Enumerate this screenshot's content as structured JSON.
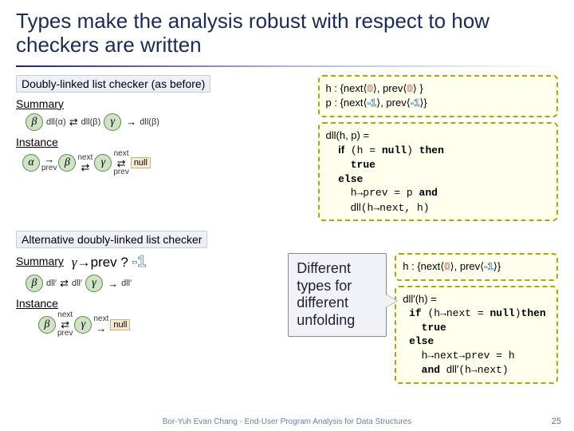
{
  "title": "Types make the analysis robust with respect to how checkers are written",
  "label1": "Doubly-linked list checker (as before)",
  "summary": "Summary",
  "instance": "Instance",
  "greek": {
    "alpha": "α",
    "beta": "β",
    "gamma": "γ"
  },
  "edge": {
    "dla": "dll(α)",
    "dlb": "dll(β)",
    "dl2": "dll′",
    "next": "next",
    "prev": "prev"
  },
  "null": "null",
  "spec1": "h : {next⟨0⟩, prev⟨0⟩ }\np : {next⟨-1⟩, prev⟨-1⟩}",
  "code1_fn": "dll(h, p) =",
  "code1_l1": "if (h = null) then",
  "code1_l2": "true",
  "code1_l3": "else",
  "code1_l4": "h→prev = p and",
  "code1_l5": "dll(h→next, h)",
  "label2": "Alternative doubly-linked list checker",
  "question": "γ→prev ? -1",
  "callout": "Different types for different unfolding",
  "spec2": "h : {next⟨0⟩, prev⟨-1⟩}",
  "code2_fn": "dll′(h) =",
  "code2_l1": "if (h→next = null) then",
  "code2_l2": "true",
  "code2_l3": "else",
  "code2_l4": "h→next→prev = h",
  "code2_l5": "and dll′(h→next)",
  "footer": "Bor-Yuh Evan Chang - End-User Program Analysis for Data Structures",
  "page": "25"
}
